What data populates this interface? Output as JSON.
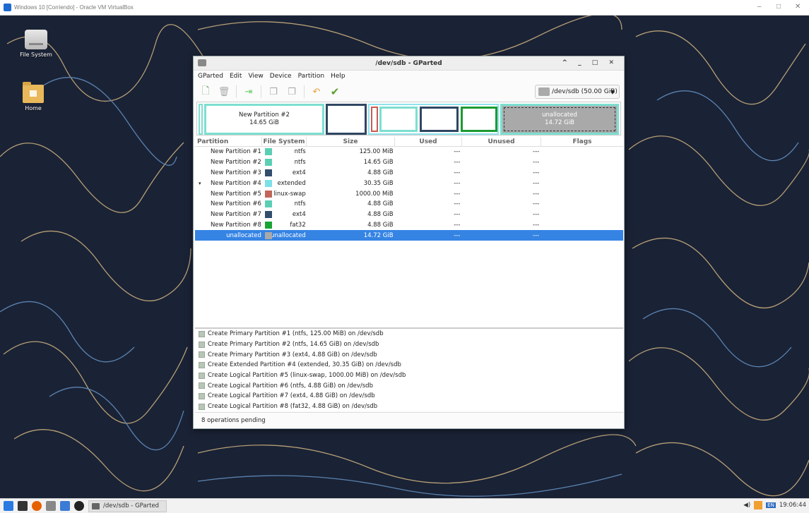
{
  "vm": {
    "title": "Windows 10 [Corriendo] - Oracle VM VirtualBox",
    "minimize": "–",
    "maximize": "□",
    "close": "✕"
  },
  "desktop": {
    "icons": [
      {
        "label": "File System",
        "icon": "drive-icon"
      },
      {
        "label": "Home",
        "icon": "home-folder-icon"
      }
    ]
  },
  "window": {
    "title": "/dev/sdb - GParted",
    "controls": "^ _ □ ✕",
    "menu": [
      "GParted",
      "Edit",
      "View",
      "Device",
      "Partition",
      "Help"
    ],
    "toolbar": [
      "new-partition-icon",
      "delete-icon",
      "resize-move-icon",
      "copy-icon",
      "paste-icon",
      "undo-icon",
      "apply-icon"
    ],
    "device_selector": "/dev/sdb (50.00 GiB)",
    "map": {
      "p2_name": "New Partition #2",
      "p2_size": "14.65 GiB",
      "unalloc_name": "unallocated",
      "unalloc_size": "14.72 GiB"
    },
    "columns": [
      "Partition",
      "File System",
      "Size",
      "Used",
      "Unused",
      "Flags"
    ],
    "rows": [
      {
        "name": "New Partition #1",
        "fs": "ntfs",
        "color": "#5bcfb4",
        "size": "125.00 MiB",
        "used": "---",
        "unused": "---",
        "flags": "",
        "indent": 0
      },
      {
        "name": "New Partition #2",
        "fs": "ntfs",
        "color": "#5bcfb4",
        "size": "14.65 GiB",
        "used": "---",
        "unused": "---",
        "flags": "",
        "indent": 0
      },
      {
        "name": "New Partition #3",
        "fs": "ext4",
        "color": "#314e6c",
        "size": "4.88 GiB",
        "used": "---",
        "unused": "---",
        "flags": "",
        "indent": 0
      },
      {
        "name": "New Partition #4",
        "fs": "extended",
        "color": "#7ddfe8",
        "size": "30.35 GiB",
        "used": "---",
        "unused": "---",
        "flags": "",
        "indent": 0,
        "expander": "▾"
      },
      {
        "name": "New Partition #5",
        "fs": "linux-swap",
        "color": "#c1665a",
        "size": "1000.00 MiB",
        "used": "---",
        "unused": "---",
        "flags": "",
        "indent": 1
      },
      {
        "name": "New Partition #6",
        "fs": "ntfs",
        "color": "#5bcfb4",
        "size": "4.88 GiB",
        "used": "---",
        "unused": "---",
        "flags": "",
        "indent": 1
      },
      {
        "name": "New Partition #7",
        "fs": "ext4",
        "color": "#314e6c",
        "size": "4.88 GiB",
        "used": "---",
        "unused": "---",
        "flags": "",
        "indent": 1
      },
      {
        "name": "New Partition #8",
        "fs": "fat32",
        "color": "#18a534",
        "size": "4.88 GiB",
        "used": "---",
        "unused": "---",
        "flags": "",
        "indent": 1
      },
      {
        "name": "unallocated",
        "fs": "unallocated",
        "color": "#a9a9a9",
        "size": "14.72 GiB",
        "used": "---",
        "unused": "---",
        "flags": "",
        "indent": 1,
        "selected": true
      }
    ],
    "operations": [
      "Create Primary Partition #1 (ntfs, 125.00 MiB) on /dev/sdb",
      "Create Primary Partition #2 (ntfs, 14.65 GiB) on /dev/sdb",
      "Create Primary Partition #3 (ext4, 4.88 GiB) on /dev/sdb",
      "Create Extended Partition #4 (extended, 30.35 GiB) on /dev/sdb",
      "Create Logical Partition #5 (linux-swap, 1000.00 MiB) on /dev/sdb",
      "Create Logical Partition #6 (ntfs, 4.88 GiB) on /dev/sdb",
      "Create Logical Partition #7 (ext4, 4.88 GiB) on /dev/sdb",
      "Create Logical Partition #8 (fat32, 4.88 GiB) on /dev/sdb"
    ],
    "status": "8 operations pending"
  },
  "taskbar": {
    "task_label": "/dev/sdb - GParted",
    "clock": "19:06:44",
    "kbd": "EN",
    "volume": "◀)"
  }
}
